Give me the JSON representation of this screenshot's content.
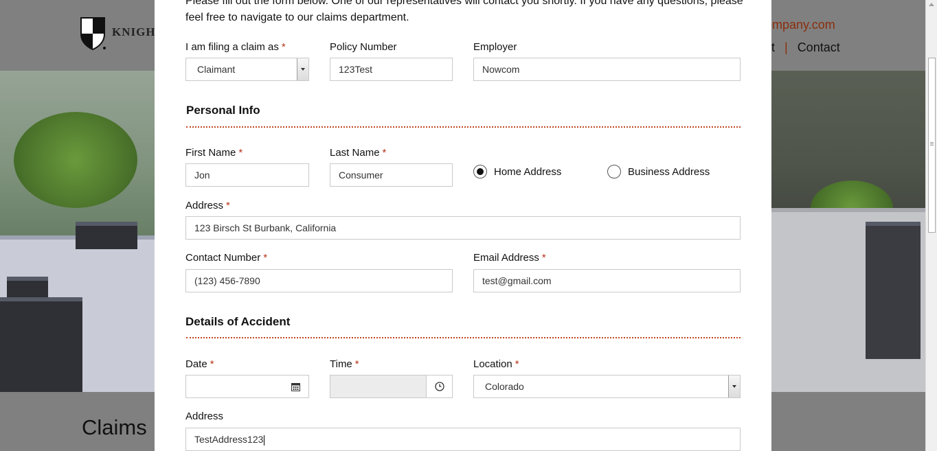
{
  "background": {
    "logo_text": "KNIGHT",
    "email_partial": "htcompany.com",
    "nav": {
      "partial_item": "nt",
      "separator": "|",
      "contact": "Contact"
    },
    "page_heading": "Claims"
  },
  "modal": {
    "intro": "Please fill out the form below. One of our representatives will contact you shortly. If you have any questions, please feel free to navigate to our claims department.",
    "required_mark": "*",
    "filing_as": {
      "label": "I am filing a claim as",
      "value": "Claimant"
    },
    "policy_number": {
      "label": "Policy Number",
      "value": "123Test"
    },
    "employer": {
      "label": "Employer",
      "value": "Nowcom"
    },
    "personal_info": {
      "title": "Personal Info",
      "first_name": {
        "label": "First Name",
        "value": "Jon"
      },
      "last_name": {
        "label": "Last Name",
        "value": "Consumer"
      },
      "address_type": [
        {
          "label": "Home Address",
          "selected": true
        },
        {
          "label": "Business Address",
          "selected": false
        }
      ],
      "address": {
        "label": "Address",
        "value": "123 Birsch St Burbank, California"
      },
      "contact_number": {
        "label": "Contact Number",
        "value": "(123) 456-7890"
      },
      "email": {
        "label": "Email Address",
        "value": "test@gmail.com"
      }
    },
    "accident": {
      "title": "Details of Accident",
      "date": {
        "label": "Date",
        "value": ""
      },
      "time": {
        "label": "Time",
        "value": ""
      },
      "location": {
        "label": "Location",
        "value": "Colorado"
      },
      "address": {
        "label": "Address",
        "value": "TestAddress123"
      }
    }
  },
  "colors": {
    "accent": "#c0451f",
    "required": "#b6331a",
    "overlay": "#808080"
  }
}
